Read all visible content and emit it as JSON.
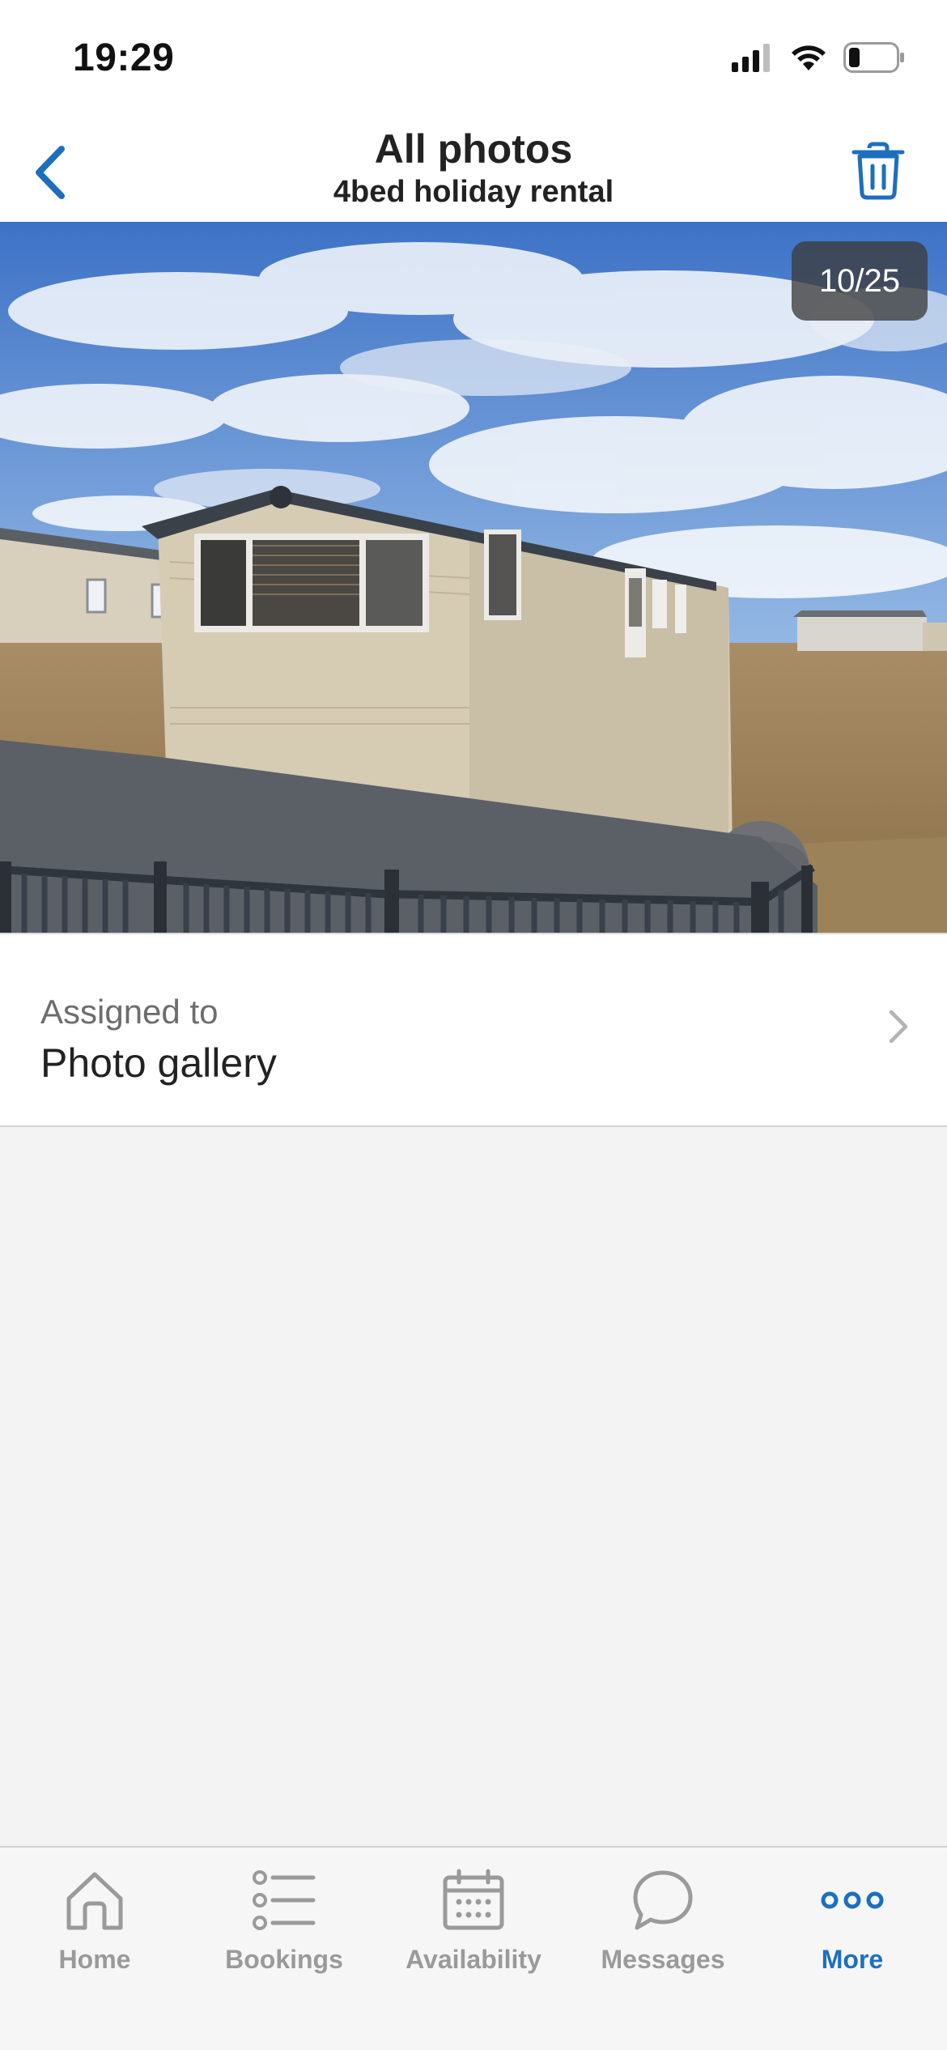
{
  "status_bar": {
    "time": "19:29"
  },
  "nav": {
    "title": "All photos",
    "subtitle": "4bed holiday rental",
    "back_icon": "chevron-left-icon",
    "delete_icon": "trash-icon",
    "accent_color": "#1d6fbe"
  },
  "photo": {
    "counter": "10/25",
    "current_index": 10,
    "total": 25
  },
  "assignment": {
    "label": "Assigned to",
    "value": "Photo gallery"
  },
  "tab_bar": {
    "active_color": "#1d6fbe",
    "inactive_color": "#9a9a9a",
    "items": [
      {
        "label": "Home",
        "icon": "home-icon",
        "active": false
      },
      {
        "label": "Bookings",
        "icon": "list-icon",
        "active": false
      },
      {
        "label": "Availability",
        "icon": "calendar-icon",
        "active": false
      },
      {
        "label": "Messages",
        "icon": "chat-bubble-icon",
        "active": false
      },
      {
        "label": "More",
        "icon": "more-dots-icon",
        "active": true
      }
    ]
  }
}
